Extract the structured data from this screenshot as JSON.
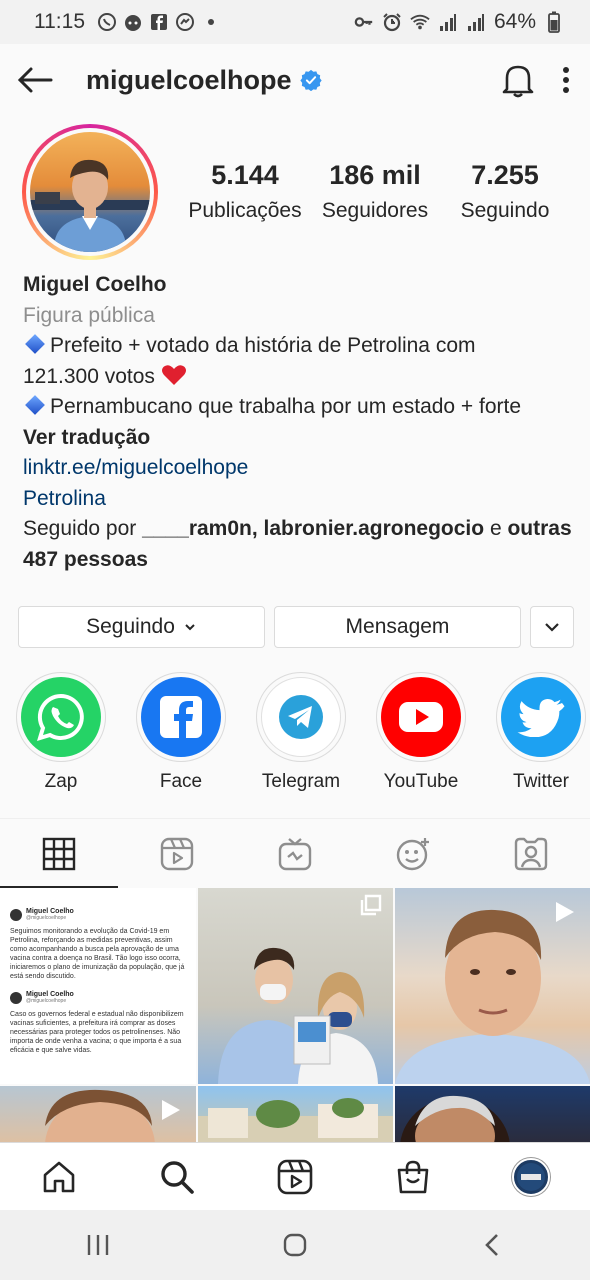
{
  "status_bar": {
    "time": "11:15",
    "battery": "64%"
  },
  "header": {
    "username": "miguelcoelhope"
  },
  "stats": [
    {
      "value": "5.144",
      "label": "Publicações"
    },
    {
      "value": "186 mil",
      "label": "Seguidores"
    },
    {
      "value": "7.255",
      "label": "Seguindo"
    }
  ],
  "bio": {
    "name": "Miguel Coelho",
    "category": "Figura pública",
    "line1": "Prefeito + votado da história de Petrolina com",
    "line1b": "121.300 votos",
    "line2": "Pernambucano que trabalha por um estado + forte",
    "translate": "Ver tradução",
    "link": "linktr.ee/miguelcoelhope",
    "location": "Petrolina",
    "followed_prefix": "Seguido por",
    "followed_user1": "____ram0n,",
    "followed_user2": "labronier.agronegocio",
    "followed_and": "e",
    "followed_others": "outras",
    "followed_count": "487 pessoas"
  },
  "buttons": {
    "following": "Seguindo",
    "message": "Mensagem"
  },
  "highlights": [
    {
      "label": "Zap",
      "icon": "whatsapp-icon",
      "color": "#25d366"
    },
    {
      "label": "Face",
      "icon": "facebook-icon",
      "color": "#1877f2"
    },
    {
      "label": "Telegram",
      "icon": "telegram-icon",
      "color": "#ffffff"
    },
    {
      "label": "YouTube",
      "icon": "youtube-icon",
      "color": "#ff0000"
    },
    {
      "label": "Twitter",
      "icon": "twitter-icon",
      "color": "#1da1f2"
    }
  ],
  "post1": {
    "author": "Miguel Coelho",
    "handle": "@miguelcoelhope",
    "para1": "Seguimos monitorando a evolução da Covid-19 em Petrolina, reforçando as medidas preventivas, assim como acompanhando a busca pela aprovação de uma vacina contra a doença no Brasil. Tão logo isso ocorra, iniciaremos o plano de imunização da população, que já está sendo discutido.",
    "para2": "Caso os governos federal e estadual não disponibilizem vacinas suficientes, a prefeitura irá comprar as doses necessárias para proteger todos os petrolinenses. Não importa de onde venha a vacina; o que importa é a sua eficácia e que salve vidas."
  },
  "colors": {
    "link": "#00376b",
    "verified": "#3897f0"
  }
}
